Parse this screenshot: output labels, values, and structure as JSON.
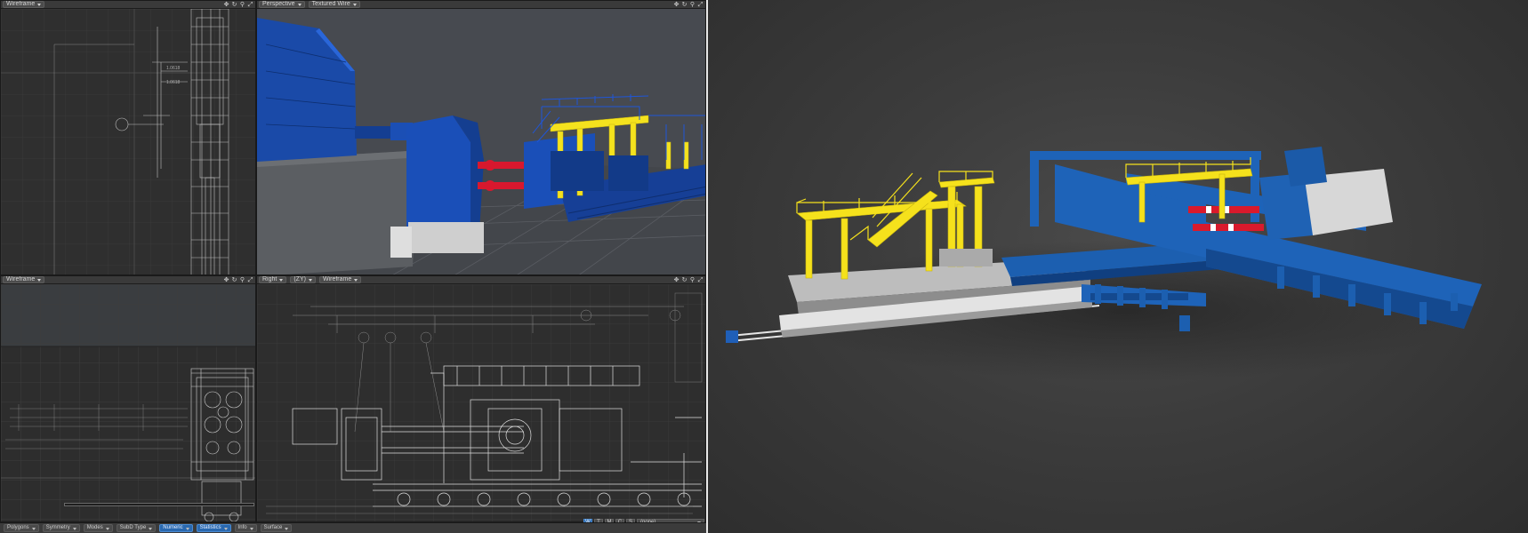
{
  "viewports": {
    "top_left": {
      "view_mode": "Wireframe"
    },
    "top_right": {
      "view_type": "Perspective",
      "view_mode": "Textured Wire"
    },
    "bottom_left": {
      "view_mode": "Wireframe"
    },
    "bottom_right": {
      "view_type": "Right",
      "xyz": "(ZY)",
      "view_mode": "Wireframe"
    }
  },
  "bottom_toolbar": {
    "buttons": [
      "Polygons",
      "Symmetry",
      "Modes",
      "SubD Type",
      "Numeric",
      "Statistics",
      "Info",
      "Surface"
    ],
    "active": [
      "Numeric",
      "Statistics"
    ]
  },
  "layer_modes": {
    "buttons": [
      "W",
      "T",
      "M",
      "C",
      "S"
    ],
    "active": "W",
    "surface_select": "(none)"
  },
  "icons": [
    "move-icon",
    "rotate-icon",
    "zoom-icon",
    "maximize-icon"
  ],
  "colors": {
    "machine_blue": "#1f56b0",
    "structure_yellow": "#f4e21e",
    "shaft_red": "#d8182e",
    "viewport_bg": "#2f2f2f",
    "render_bg": "#3c3c3c"
  }
}
